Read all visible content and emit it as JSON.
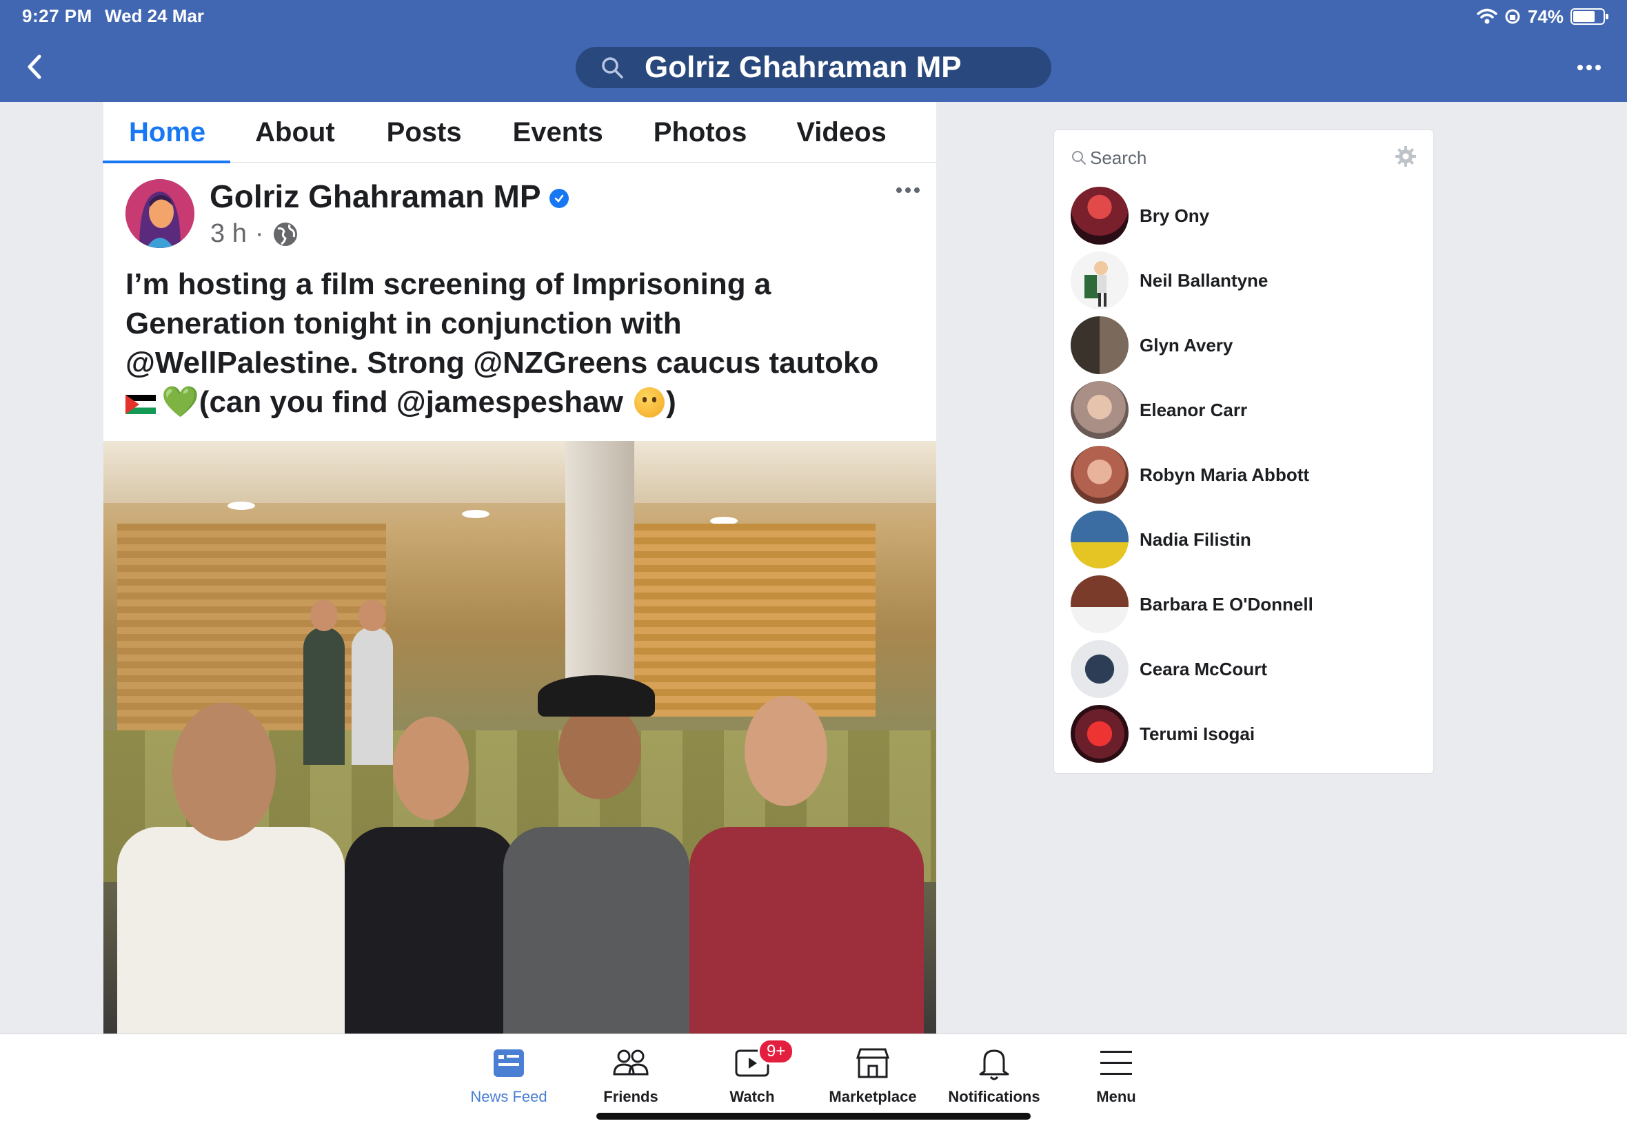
{
  "status_bar": {
    "time": "9:27 PM",
    "date": "Wed 24 Mar",
    "battery": "74%",
    "battery_level": 0.74
  },
  "header": {
    "search_query": "Golriz Ghahraman MP"
  },
  "tabs": [
    {
      "label": "Home",
      "active": true
    },
    {
      "label": "About"
    },
    {
      "label": "Posts"
    },
    {
      "label": "Events"
    },
    {
      "label": "Photos"
    },
    {
      "label": "Videos"
    }
  ],
  "post": {
    "author": "Golriz Ghahraman MP",
    "time": "3 h",
    "separator": "·",
    "text_line1": "I’m hosting a film screening of Imprisoning a",
    "text_line2": "Generation tonight in conjunction with",
    "text_line3": "@WellPalestine. Strong @NZGreens caucus tautoko",
    "text_line4_heart": "💚",
    "text_line4": "(can you find @jamespeshaw",
    "text_line4_end": ")"
  },
  "contacts": {
    "search_placeholder": "Search",
    "items": [
      {
        "name": "Bry Ony",
        "color": "#7a1f2c"
      },
      {
        "name": "Neil Ballantyne",
        "color": "#f3f3f3"
      },
      {
        "name": "Glyn Avery",
        "color": "#4a4036"
      },
      {
        "name": "Eleanor Carr",
        "color": "#a98f86"
      },
      {
        "name": "Robyn Maria Abbott",
        "color": "#b2614e"
      },
      {
        "name": "Nadia Filistin",
        "color": "#3b6da3"
      },
      {
        "name": "Barbara E O'Donnell",
        "color": "#7b3b2b"
      },
      {
        "name": "Ceara McCourt",
        "color": "#50637c"
      },
      {
        "name": "Terumi Isogai",
        "color": "#c23434"
      }
    ]
  },
  "bottom_nav": [
    {
      "label": "News Feed",
      "icon": "news-feed-icon",
      "active": true
    },
    {
      "label": "Friends",
      "icon": "friends-icon"
    },
    {
      "label": "Watch",
      "icon": "watch-icon",
      "badge": "9+"
    },
    {
      "label": "Marketplace",
      "icon": "marketplace-icon"
    },
    {
      "label": "Notifications",
      "icon": "bell-icon"
    },
    {
      "label": "Menu",
      "icon": "menu-icon"
    }
  ],
  "colors": {
    "brand_blue": "#4267b2",
    "link_blue": "#1877f2",
    "badge_red": "#e41e3f"
  }
}
